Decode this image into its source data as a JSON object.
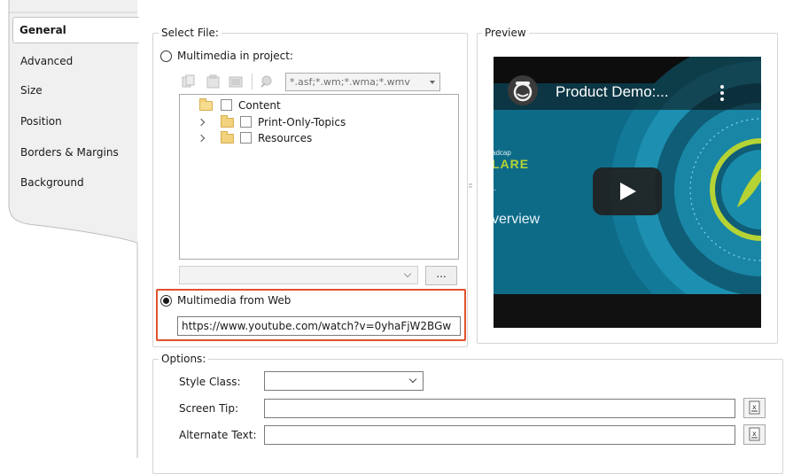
{
  "tabs": [
    {
      "label": "General",
      "active": true
    },
    {
      "label": "Advanced",
      "active": false
    },
    {
      "label": "Size",
      "active": false
    },
    {
      "label": "Position",
      "active": false
    },
    {
      "label": "Borders & Margins",
      "active": false
    },
    {
      "label": "Background",
      "active": false
    }
  ],
  "select_file": {
    "legend": "Select File:",
    "radio_project_label": "Multimedia in project:",
    "radio_project_checked": false,
    "filter_value": "*.asf;*.wm;*.wma;*.wmv",
    "toolbar_icons": [
      "copy-icon",
      "paste-icon",
      "folder-icon",
      "pin-icon"
    ],
    "tree": [
      {
        "label": "Content",
        "expandable": false
      },
      {
        "label": "Print-Only-Topics",
        "expandable": true
      },
      {
        "label": "Resources",
        "expandable": true
      }
    ],
    "browse_label": "...",
    "radio_web_label": "Multimedia from Web",
    "radio_web_checked": true,
    "url_value": "https://www.youtube.com/watch?v=0yhaFjW2BGw"
  },
  "preview": {
    "legend": "Preview",
    "video_title": "Product Demo:...",
    "brand_top": "adcap",
    "brand_name": "LARE",
    "brand_dot": ".",
    "overview_text": "verview",
    "colors": {
      "teal": "#1d8fb0",
      "dark_teal": "#0f5d76",
      "lime": "#b5d334",
      "play_bg": "#212121"
    }
  },
  "options": {
    "legend": "Options:",
    "style_class_label": "Style Class:",
    "style_class_value": "",
    "screen_tip_label": "Screen Tip:",
    "screen_tip_value": "",
    "alt_text_label": "Alternate Text:",
    "alt_text_value": ""
  },
  "colors": {
    "highlight": "#e0522c",
    "groupbox_border": "#d5d5d5"
  }
}
